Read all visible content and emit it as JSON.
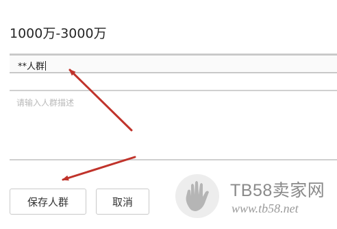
{
  "form": {
    "amount_range": "1000万-3000万",
    "name_value": "**人群",
    "description_placeholder": "请输入人群描述"
  },
  "buttons": {
    "save_label": "保存人群",
    "cancel_label": "取消"
  },
  "annotations": {
    "arrow_color": "#c0332b",
    "arrow_count": 2
  },
  "watermark": {
    "brand": "TB58卖家网",
    "url": "www.tb58.net",
    "logo_icon": "hand-icon",
    "color": "#8a8a8a"
  }
}
